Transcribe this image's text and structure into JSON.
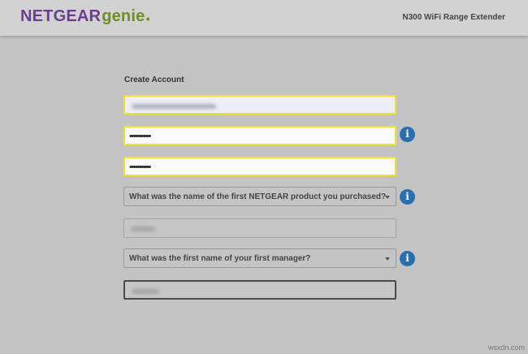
{
  "header": {
    "logo_brand": "NETGEAR",
    "logo_genie": "genie",
    "logo_dot": "●",
    "product_name": "N300 WiFi Range Extender"
  },
  "form": {
    "title": "Create Account",
    "password_mask": "•••••••••••",
    "confirm_password_mask": "•••••••••••",
    "security_question_1": "What was the name of the first NETGEAR product you purchased?",
    "security_question_2": "What was the first name of your first manager?",
    "info_glyph": "i"
  },
  "icons": {
    "info": "info-icon",
    "dropdown": "chevron-down-icon"
  },
  "colors": {
    "brand_purple": "#6b3f8f",
    "genie_green": "#6e8f28",
    "highlight_yellow": "#f0e030",
    "info_blue": "#2a6fb0"
  },
  "watermark": "wsxdn.com"
}
